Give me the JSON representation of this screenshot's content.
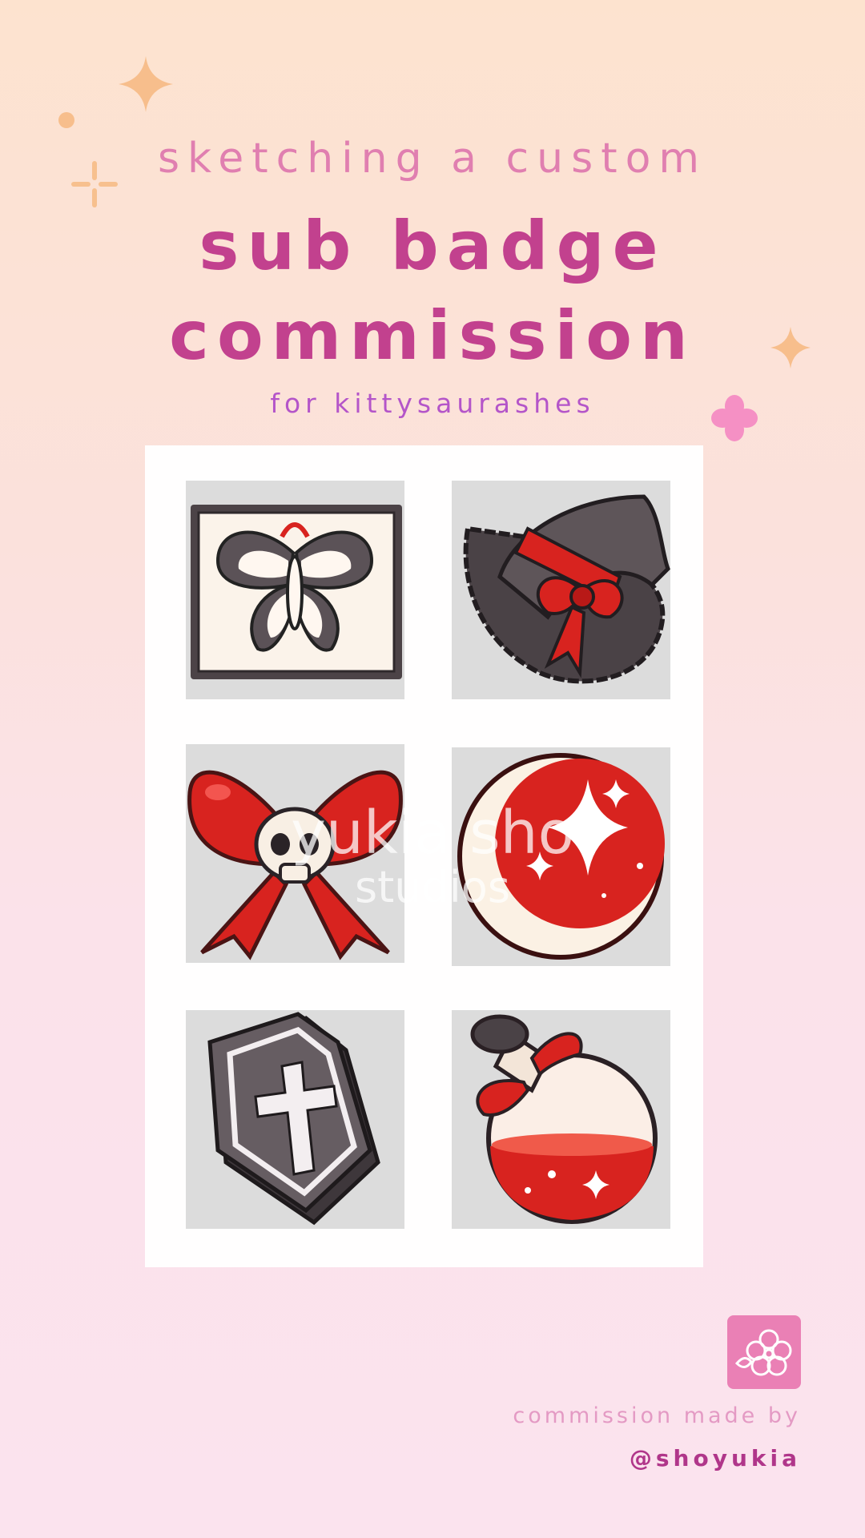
{
  "header": {
    "line1": "sketching a custom",
    "line2": "sub badge",
    "line3": "commission",
    "subtitle": "for kittysaurashes"
  },
  "badges": [
    {
      "icon": "framed-butterfly-icon"
    },
    {
      "icon": "witch-hat-icon"
    },
    {
      "icon": "skull-bow-icon"
    },
    {
      "icon": "crescent-moon-icon"
    },
    {
      "icon": "coffin-cross-icon"
    },
    {
      "icon": "potion-bottle-icon"
    }
  ],
  "watermark": {
    "line1": "yukia sho",
    "line2": "studios"
  },
  "footer": {
    "credit_label": "commission made by",
    "handle": "@shoyukia",
    "logo_icon": "sakura-logo-icon"
  },
  "colors": {
    "title": "#c2418e",
    "title_light": "#e07fb0",
    "subtitle": "#b455c9",
    "accent_red": "#d8231f",
    "logo_bg": "#ea80b5"
  }
}
